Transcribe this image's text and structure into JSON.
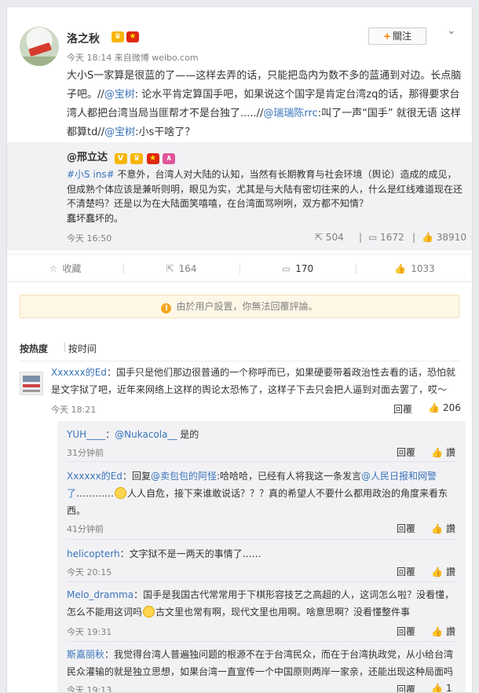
{
  "post": {
    "author": "洛之秋",
    "follow_label": "關注",
    "follow_plus": "+",
    "time": "今天 18:14",
    "source": "来自微博 weibo.com",
    "content_main": "大小S一家算是很蓝的了——这样去弄的话，只能把岛内为数不多的蓝通到对边。长点脑子吧。//",
    "mention_baoshu": "@宝树",
    "content_2": ": 论水平肯定算国手吧，如果说这个国字是肯定台湾zq的话，那得要求台湾人都把台湾当局当匪帮才不是台独了.....//",
    "mention_ruiruichen": "@瑞瑞陈rrc",
    "content_3": ":叫了一声“国手” 就很无语 这样都算td//",
    "mention_baoshu_2": "@宝树",
    "content_4": ":小s干啥了？"
  },
  "repost": {
    "author": "@邢立达",
    "hashtag": "#小S ins#",
    "text": " 不意外，台湾人对大陆的认知，当然有长期教育与社会环境（舆论）造成的成见，但成熟个体应该是兼听则明，眼见为实，尤其是与大陆有密切往来的人，什么是红线难道现在还不清楚吗？还是以为在大陆面笑嘻嘻，在台湾面骂咧咧，双方都不知情？",
    "text_2": "蠢坏蠢坏的。",
    "time": "今天 16:50",
    "reposts": "504",
    "comments": "1672",
    "likes": "38910"
  },
  "actions": {
    "collect": "收藏",
    "repost_count": "164",
    "comment_count": "170",
    "like_count": "1033"
  },
  "notice": "由於用户設置，你無法回覆評論。",
  "sort": {
    "hot": "按热度",
    "time": "按时间"
  },
  "top_comment": {
    "author": "Xxxxxx的Ed",
    "text": "：国手只是他们那边很普通的一个称呼而已，如果硬要带着政治性去看的话，恐怕就是文字狱了吧，近年来网络上这样的舆论太恐怖了，这样子下去只会把人逼到对面去罢了，哎～",
    "time": "今天 18:21",
    "reply": "回覆",
    "likes": "206"
  },
  "sub_comments": [
    {
      "author": "YUH____",
      "mention": "@Nukacola__",
      "text": " 是的",
      "time": "31分钟前",
      "reply": "回覆",
      "like": "讚"
    },
    {
      "author": "Xxxxxx的Ed",
      "prefix": "：回复",
      "mention": "@卖包包的阿怪",
      "text_a": ":哈哈哈，已经有人将我这一条发言",
      "mention_2": "@人民日报和网警了",
      "text_b": "…………",
      "text_c": "人人自危，接下来谁敢说话？？？真的希望人不要什么都用政治的角度来看东西。",
      "time": "41分钟前",
      "reply": "回覆",
      "like": "讚"
    },
    {
      "author": "helicopterh",
      "text": "：文字狱不是一两天的事情了……",
      "time": "今天 20:15",
      "reply": "回覆",
      "like": "讚"
    },
    {
      "author": "Melo_dramma",
      "text_a": "：国手是我国古代常常用于下棋形容技艺之高超的人，这词怎么啦？没看懂，怎么不能用这词吗",
      "text_b": "古文里也常有啊，现代文里也用啊。啥意思啊？没看懂整件事",
      "time": "今天 19:31",
      "reply": "回覆",
      "like": "讚"
    },
    {
      "author": "斯嘉丽秋",
      "text": "：我觉得台湾人普遍独问题的根源不在于台湾民众，而在于台湾执政党，从小给台湾民众灌输的就是独立思想，如果台湾一直宣传一个中国原则两岸一家亲，还能出现这种局面吗",
      "time": "今天 19:13",
      "reply": "回覆",
      "likes": "1"
    }
  ],
  "colors": {
    "link": "#eb7350",
    "name": "#3a74ba",
    "accent": "#ff8200",
    "muted": "#808080"
  }
}
